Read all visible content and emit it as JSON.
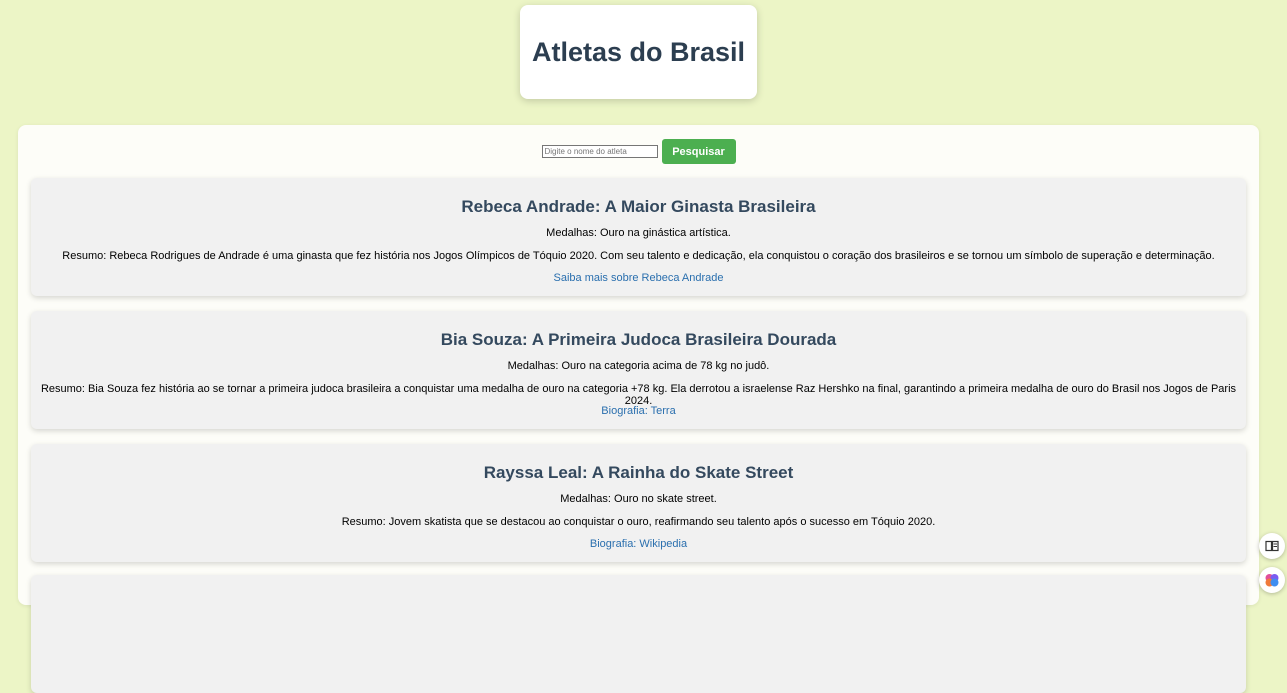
{
  "header": {
    "title": "Atletas do Brasil"
  },
  "search": {
    "placeholder": "Digite o nome do atleta",
    "button_label": "Pesquisar"
  },
  "athletes": [
    {
      "title": "Rebeca Andrade: A Maior Ginasta Brasileira",
      "medals": "Medalhas: Ouro na ginástica artística.",
      "summary": "Resumo: Rebeca Rodrigues de Andrade é uma ginasta que fez história nos Jogos Olímpicos de Tóquio 2020. Com seu talento e dedicação, ela conquistou o coração dos brasileiros e se tornou um símbolo de superação e determinação.",
      "link": "Saiba mais sobre Rebeca Andrade"
    },
    {
      "title": "Bia Souza: A Primeira Judoca Brasileira Dourada",
      "medals": "Medalhas: Ouro na categoria acima de 78 kg no judô.",
      "summary": "Resumo: Bia Souza fez história ao se tornar a primeira judoca brasileira a conquistar uma medalha de ouro na categoria +78 kg. Ela derrotou a israelense Raz Hershko na final, garantindo a primeira medalha de ouro do Brasil nos Jogos de Paris 2024.",
      "link": "Biografia: Terra"
    },
    {
      "title": "Rayssa Leal: A Rainha do Skate Street",
      "medals": "Medalhas: Ouro no skate street.",
      "summary": "Resumo: Jovem skatista que se destacou ao conquistar o ouro, reafirmando seu talento após o sucesso em Tóquio 2020.",
      "link": "Biografia: Wikipedia"
    }
  ],
  "side_buttons": {
    "reader_icon": "book-icon",
    "extension_icon": "brain-icon"
  },
  "colors": {
    "background": "#ecf5c6",
    "accent": "#4caf50",
    "heading": "#2c3e50",
    "link": "#2a6fae"
  }
}
